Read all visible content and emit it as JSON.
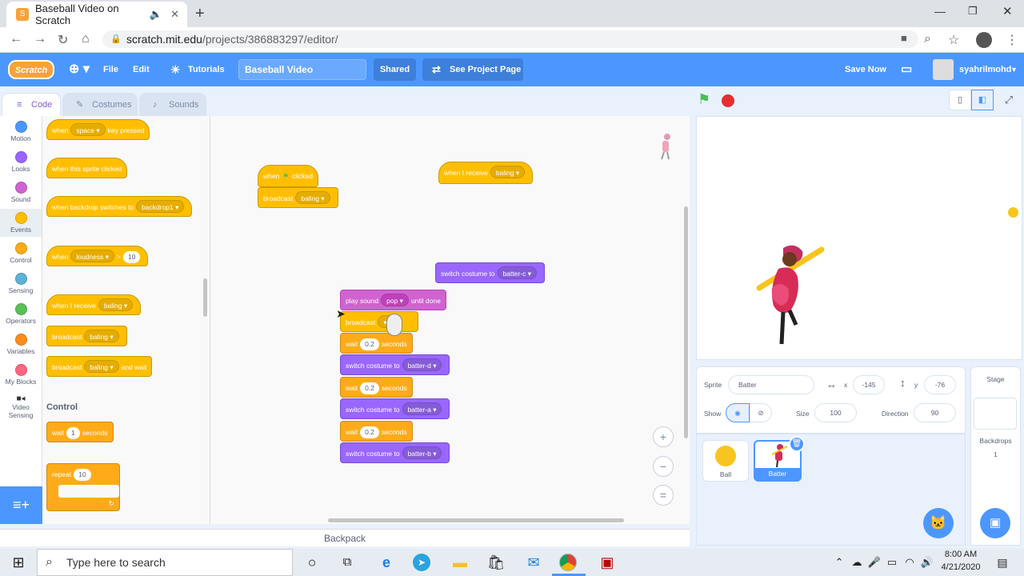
{
  "browser": {
    "tab_title": "Baseball Video on Scratch",
    "url_domain": "scratch.mit.edu",
    "url_path": "/projects/386883297/editor/"
  },
  "menubar": {
    "logo": "Scratch",
    "file": "File",
    "edit": "Edit",
    "tutorials": "Tutorials",
    "project_title": "Baseball Video",
    "shared": "Shared",
    "see_project_page": "See Project Page",
    "save_now": "Save Now",
    "username": "syahrilmohd"
  },
  "tabs": {
    "code": "Code",
    "costumes": "Costumes",
    "sounds": "Sounds"
  },
  "categories": [
    {
      "label": "Motion",
      "color": "#4c97ff"
    },
    {
      "label": "Looks",
      "color": "#9966ff"
    },
    {
      "label": "Sound",
      "color": "#cf63cf"
    },
    {
      "label": "Events",
      "color": "#ffbf00"
    },
    {
      "label": "Control",
      "color": "#ffab19"
    },
    {
      "label": "Sensing",
      "color": "#5cb1d6"
    },
    {
      "label": "Operators",
      "color": "#59c059"
    },
    {
      "label": "Variables",
      "color": "#ff8c1a"
    },
    {
      "label": "My Blocks",
      "color": "#ff6680"
    },
    {
      "label": "Video Sensing",
      "color": "#0fbd8c"
    }
  ],
  "palette": {
    "key_pressed": {
      "a": "when",
      "b": "space",
      "c": "key pressed"
    },
    "sprite_clicked": "when this sprite clicked",
    "backdrop_switch": {
      "a": "when backdrop switches to",
      "b": "backdrop1"
    },
    "loudness": {
      "a": "when",
      "b": "loudness",
      "c": ">",
      "d": "10"
    },
    "receive": {
      "a": "when I receive",
      "b": "baling"
    },
    "broadcast": {
      "a": "broadcast",
      "b": "baling"
    },
    "broadcast_wait": {
      "a": "broadcast",
      "b": "baling",
      "c": "and wait"
    },
    "control_heading": "Control",
    "wait": {
      "a": "wait",
      "b": "1",
      "c": "seconds"
    },
    "repeat": {
      "a": "repeat",
      "b": "10"
    }
  },
  "workspace": {
    "flag_hat": {
      "a": "when",
      "b": "clicked"
    },
    "broadcast1": {
      "a": "broadcast",
      "b": "baling"
    },
    "receive_hat": {
      "a": "when I receive",
      "b": "baling"
    },
    "switch_c": {
      "a": "switch costume to",
      "b": "batter-c"
    },
    "play_sound": {
      "a": "play sound",
      "b": "pop",
      "c": "until done"
    },
    "broadcast2": {
      "a": "broadcast"
    },
    "wait1": {
      "a": "wait",
      "b": "0.2",
      "c": "seconds"
    },
    "switch_d": {
      "a": "switch costume to",
      "b": "batter-d"
    },
    "wait2": {
      "a": "wait",
      "b": "0.2",
      "c": "seconds"
    },
    "switch_a": {
      "a": "switch costume to",
      "b": "batter-a"
    },
    "wait3": {
      "a": "wait",
      "b": "0.2",
      "c": "seconds"
    },
    "switch_b": {
      "a": "switch costume to",
      "b": "batter-b"
    }
  },
  "backpack": "Backpack",
  "sprite_info": {
    "sprite_label": "Sprite",
    "sprite_name": "Batter",
    "x_label": "x",
    "x": "-145",
    "y_label": "y",
    "y": "-76",
    "show_label": "Show",
    "size_label": "Size",
    "size": "100",
    "direction_label": "Direction",
    "direction": "90"
  },
  "sprites": [
    {
      "name": "Ball"
    },
    {
      "name": "Batter"
    }
  ],
  "stage_pane": {
    "title": "Stage",
    "backdrops_label": "Backdrops",
    "backdrops_count": "1"
  },
  "taskbar": {
    "search_placeholder": "Type here to search",
    "time": "8:00 AM",
    "date": "4/21/2020"
  }
}
